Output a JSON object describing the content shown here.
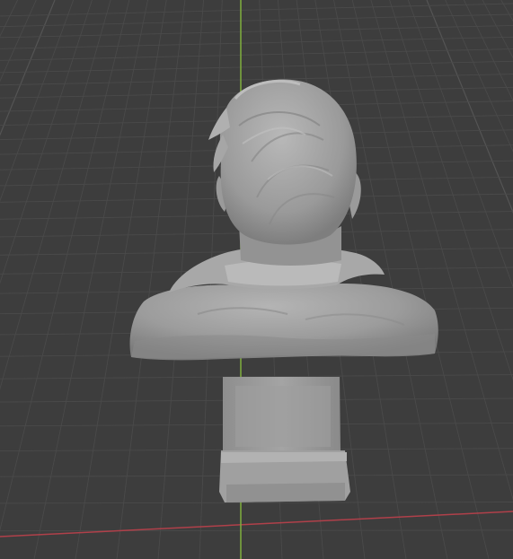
{
  "viewport": {
    "background": "#3d3d3d",
    "grid_minor_color": "#4a4a4a",
    "grid_major_color": "#545454",
    "x_axis_color": "#b0404a",
    "y_axis_color": "#7fae3c"
  },
  "model": {
    "name": "sculpted bust",
    "view": "back",
    "material_color": "#9a9a9a"
  }
}
